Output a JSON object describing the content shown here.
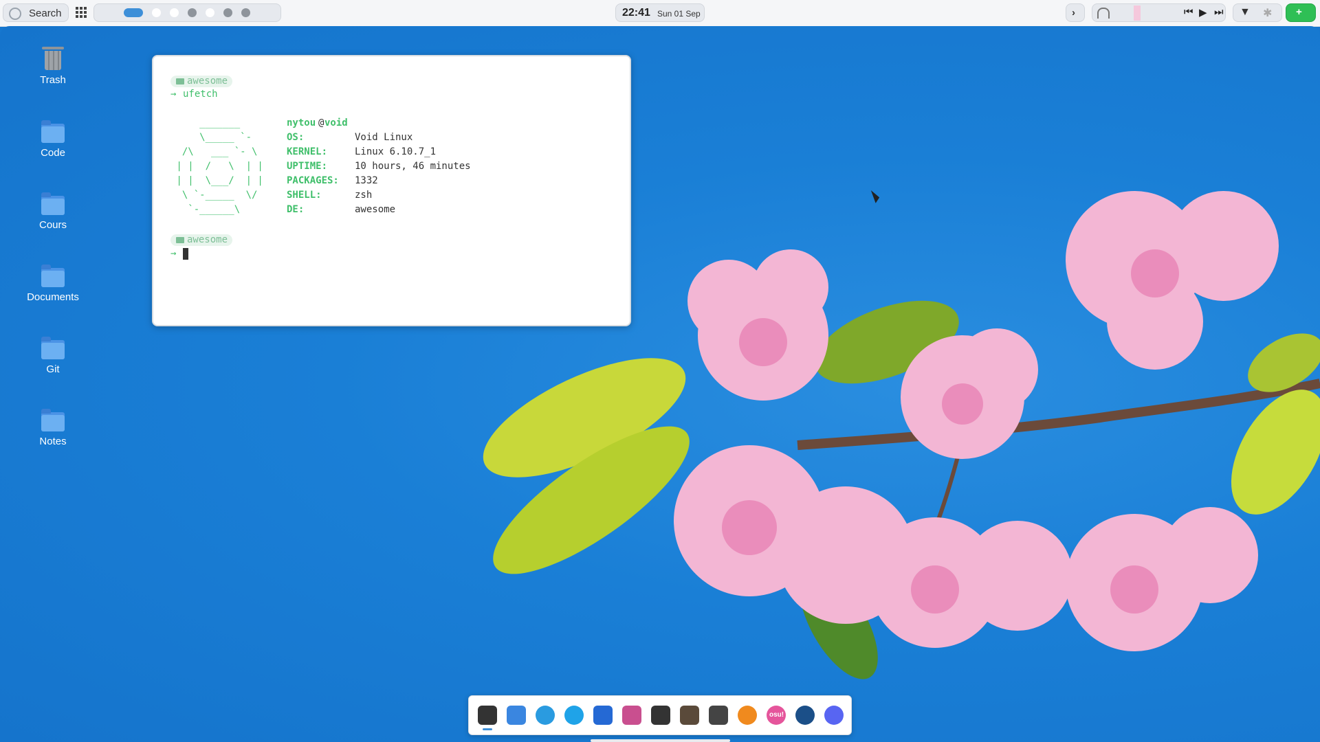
{
  "topbar": {
    "search_label": "Search",
    "clock_time": "22:41",
    "clock_date": "Sun 01 Sep",
    "workspaces": [
      {
        "state": "active"
      },
      {
        "state": "empty"
      },
      {
        "state": "empty"
      },
      {
        "state": "filled"
      },
      {
        "state": "empty"
      },
      {
        "state": "filled"
      },
      {
        "state": "filled"
      }
    ],
    "media_controls": [
      "previous-icon",
      "play-icon",
      "next-icon"
    ],
    "battery_status": "charging",
    "accent_color": "#3d8fd8",
    "battery_color": "#2fbf55"
  },
  "desktop_icons": [
    {
      "label": "Trash",
      "icon": "trash-icon"
    },
    {
      "label": "Code",
      "icon": "folder-icon"
    },
    {
      "label": "Cours",
      "icon": "folder-icon"
    },
    {
      "label": "Documents",
      "icon": "folder-icon"
    },
    {
      "label": "Git",
      "icon": "folder-icon"
    },
    {
      "label": "Notes",
      "icon": "folder-icon"
    }
  ],
  "terminal": {
    "prompt_dir_1": "awesome",
    "prompt_symbol": "→",
    "command": "ufetch",
    "user": "nytou",
    "at": "@",
    "host": "void",
    "ascii_art": [
      "     _______",
      "     \\_____ `-",
      "  /\\   ___ `- \\",
      " | |  /   \\  | |",
      " | |  \\___/  | |",
      "  \\ `-_____  \\/",
      "   `-______\\"
    ],
    "info": [
      {
        "key": "OS:",
        "value": "Void Linux"
      },
      {
        "key": "KERNEL:",
        "value": "Linux 6.10.7_1"
      },
      {
        "key": "UPTIME:",
        "value": "10 hours, 46 minutes"
      },
      {
        "key": "PACKAGES:",
        "value": "1332"
      },
      {
        "key": "SHELL:",
        "value": "zsh"
      },
      {
        "key": "DE:",
        "value": "awesome"
      }
    ],
    "prompt_dir_2": "awesome",
    "text_color": "#3fbf6a"
  },
  "dock": [
    {
      "name": "terminal-app-icon",
      "color": "#333333",
      "active": true
    },
    {
      "name": "files-app-icon",
      "color": "#3a86e0"
    },
    {
      "name": "browser-app-icon",
      "color": "#2a9be0"
    },
    {
      "name": "media-player-app-icon",
      "color": "#1fa3e8"
    },
    {
      "name": "text-editor-app-icon",
      "color": "#2569d4"
    },
    {
      "name": "tasks-app-icon",
      "color": "#c94f8f"
    },
    {
      "name": "unity-app-icon",
      "color": "#333333"
    },
    {
      "name": "gimp-app-icon",
      "color": "#5a4a3a"
    },
    {
      "name": "screenshot-app-icon",
      "color": "#444444"
    },
    {
      "name": "blender-app-icon",
      "color": "#f08a1e"
    },
    {
      "name": "osu-app-icon",
      "color": "#e5559b"
    },
    {
      "name": "steam-app-icon",
      "color": "#1b4f88"
    },
    {
      "name": "discord-app-icon",
      "color": "#5865f2"
    }
  ],
  "osu_label": "osu!"
}
